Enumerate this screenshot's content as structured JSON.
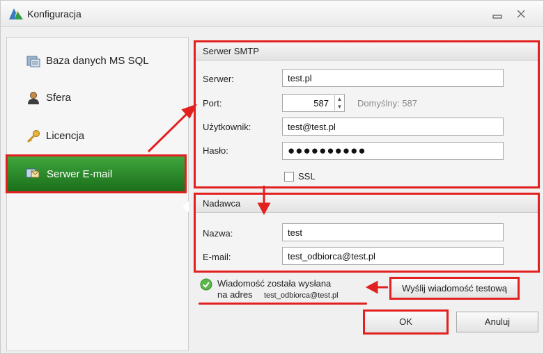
{
  "window": {
    "title": "Konfiguracja",
    "icons": {
      "app": "konfiguracja-app-icon",
      "minimize": "minimize-icon",
      "close": "close-icon"
    }
  },
  "sidebar": {
    "items": [
      {
        "label": "Baza danych MS SQL",
        "icon": "database-icon",
        "selected": false
      },
      {
        "label": "Sfera",
        "icon": "user-icon",
        "selected": false
      },
      {
        "label": "Licencja",
        "icon": "key-icon",
        "selected": false
      },
      {
        "label": "Serwer E-mail",
        "icon": "email-server-icon",
        "selected": true
      }
    ]
  },
  "smtp": {
    "title": "Serwer SMTP",
    "server_label": "Serwer:",
    "server_value": "test.pl",
    "port_label": "Port:",
    "port_value": "587",
    "port_default": "Domyślny: 587",
    "user_label": "Użytkownik:",
    "user_value": "test@test.pl",
    "password_label": "Hasło:",
    "password_masked": "●●●●●●●●●●",
    "ssl_label": "SSL",
    "ssl_checked": false
  },
  "sender": {
    "title": "Nadawca",
    "name_label": "Nazwa:",
    "name_value": "test",
    "email_label": "E-mail:",
    "email_value": "test_odbiorca@test.pl"
  },
  "status": {
    "icon": "success-check-icon",
    "line1": "Wiadomość została wysłana",
    "line2_prefix": "na adres",
    "line2_address": "test_odbiorca@test.pl"
  },
  "buttons": {
    "test": "Wyślij wiadomość testową",
    "ok": "OK",
    "cancel": "Anuluj"
  },
  "colors": {
    "highlight": "#e32020",
    "selected_nav": "#2e8b2e",
    "status_ok": "#4caf3a"
  }
}
